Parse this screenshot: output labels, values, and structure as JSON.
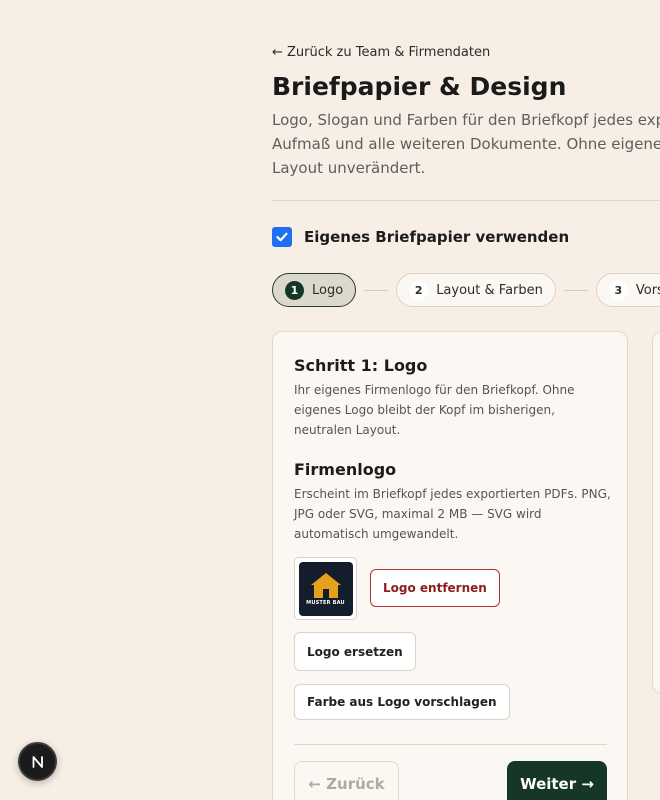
{
  "nav": {
    "back_label": "← Zurück zu Team & Firmendaten"
  },
  "header": {
    "title": "Briefpapier & Design",
    "description_lines": [
      "Logo, Slogan und Farben für den Briefkopf jedes expor",
      "Aufmaß und alle weiteren Dokumente. Ohne eigenes B",
      "Layout unverändert."
    ]
  },
  "toggle": {
    "label": "Eigenes Briefpapier verwenden",
    "checked": true
  },
  "stepper": {
    "steps": [
      {
        "num": "1",
        "label": "Logo",
        "active": true
      },
      {
        "num": "2",
        "label": "Layout & Farben",
        "active": false
      },
      {
        "num": "3",
        "label": "Vorsc",
        "active": false
      }
    ]
  },
  "step_card": {
    "title": "Schritt 1: Logo",
    "description": "Ihr eigenes Firmenlogo für den Briefkopf. Ohne eigenes Logo bleibt der Kopf im bisherigen, neutralen Layout.",
    "section_title": "Firmenlogo",
    "section_description": "Erscheint im Briefkopf jedes exportierten PDFs. PNG, JPG oder SVG, maximal 2 MB — SVG wird automatisch umgewandelt.",
    "logo_text": "MUSTER BAU",
    "remove_label": "Logo entfernen",
    "replace_label": "Logo ersetzen",
    "suggest_label": "Farbe aus Logo vorschlagen",
    "prev_label": "← Zurück",
    "next_label": "Weiter →"
  },
  "badge": {
    "letter": "N"
  },
  "colors": {
    "accent_dark": "#163627",
    "checkbox": "#1e6ff1",
    "danger": "#b53030",
    "background": "#f7eee5"
  }
}
